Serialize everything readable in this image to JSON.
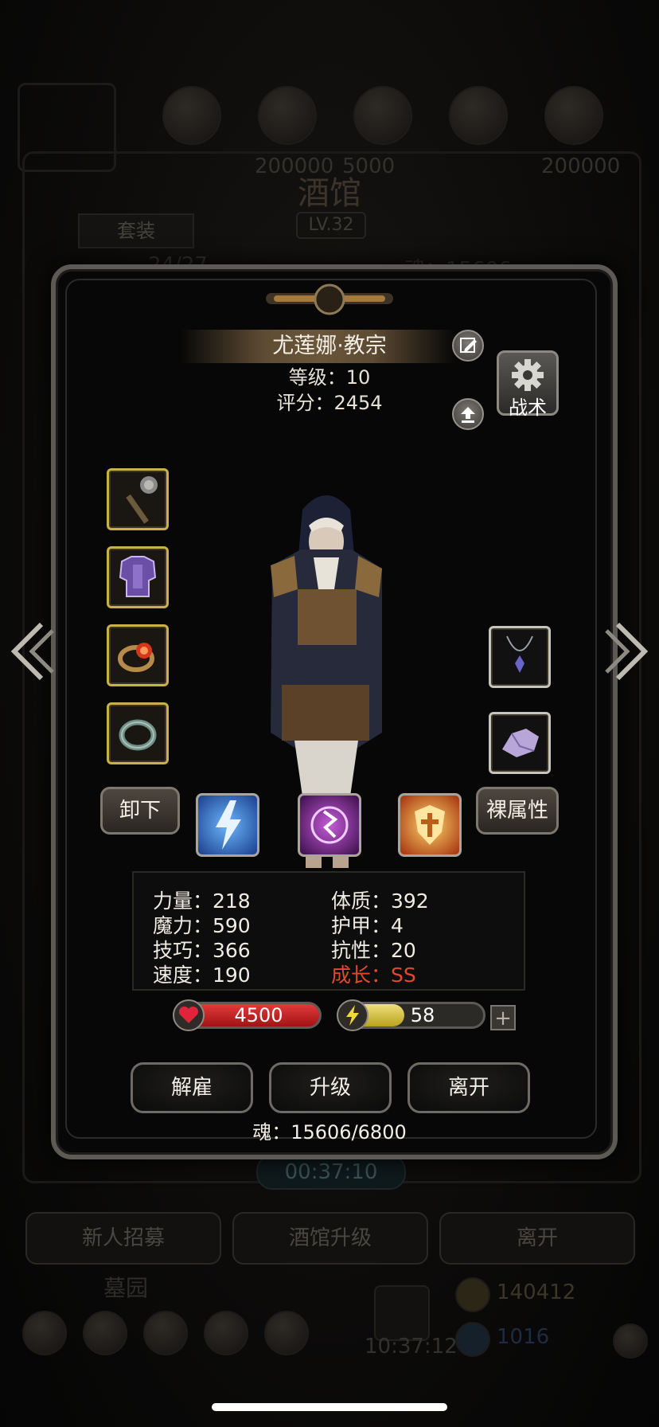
{
  "background": {
    "title": "酒馆",
    "level": "LV.32",
    "set_label": "套装",
    "count_text": "24/27",
    "soul_text": "魂：15606",
    "resource_values": [
      "200000",
      "5000",
      "200000"
    ],
    "timer": "00:37:10",
    "buttons": [
      "新人招募",
      "酒馆升级",
      "离开"
    ],
    "graveyard_label": "墓园",
    "gold": "140412",
    "gems": "1016",
    "clock": "10:37:12"
  },
  "hero": {
    "name": "尤莲娜·教宗",
    "level_line": "等级：10",
    "score_line": "评分：2454",
    "tactics_label": "战术"
  },
  "equipment_left": [
    "mace",
    "purple-armor",
    "ruby-ring",
    "jade-ring"
  ],
  "equipment_right": [
    "amethyst-necklace",
    "amethyst-crystal"
  ],
  "actions_row": {
    "unequip": "卸下",
    "base_attr": "裸属性"
  },
  "skills": [
    "lightning-skill",
    "purple-sigil-skill",
    "holy-shield-skill"
  ],
  "stats": {
    "strength": "力量：218",
    "magic": "魔力：590",
    "skill": "技巧：366",
    "speed": "速度：190",
    "constitution": "体质：392",
    "armor": "护甲：4",
    "resistance": "抗性：20",
    "growth": "成长：SS"
  },
  "bars": {
    "hp": "4500",
    "energy": "58",
    "energy_fill": 0.45,
    "plus": "+"
  },
  "buttons": {
    "dismiss": "解雇",
    "upgrade": "升级",
    "leave": "离开"
  },
  "soul_footer": "魂：15606/6800",
  "colors": {
    "gold_border": "#c9b048",
    "hp_red": "#c41e1e",
    "energy_yellow": "#d9c23a",
    "growth_red": "#e04a2b"
  }
}
